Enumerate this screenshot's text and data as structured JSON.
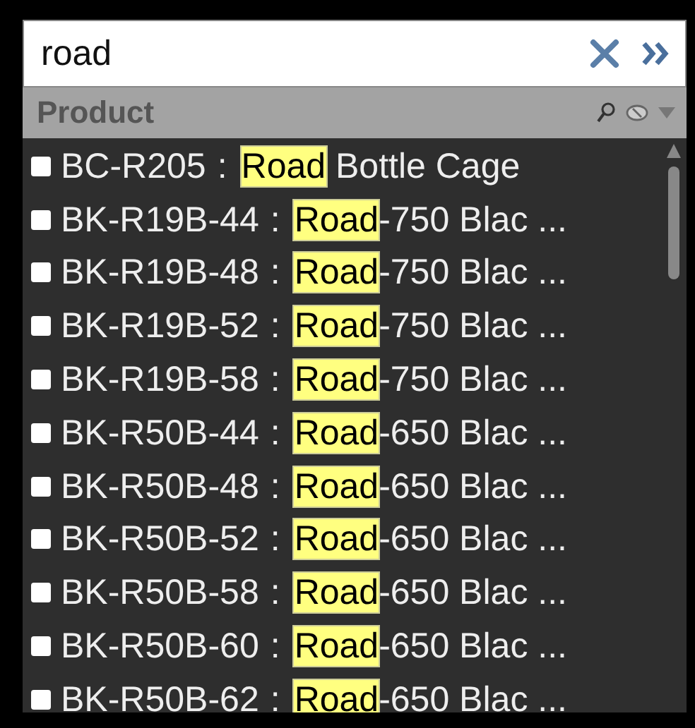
{
  "search": {
    "value": "road"
  },
  "header": {
    "title": "Product"
  },
  "items": [
    {
      "checked": false,
      "code": "BC-R205",
      "separator": ":",
      "match": "Road",
      "rest": " Bottle Cage"
    },
    {
      "checked": false,
      "code": "BK-R19B-44",
      "separator": ":",
      "match": "Road",
      "rest": "-750 Blac ..."
    },
    {
      "checked": false,
      "code": "BK-R19B-48",
      "separator": ":",
      "match": "Road",
      "rest": "-750 Blac ..."
    },
    {
      "checked": false,
      "code": "BK-R19B-52",
      "separator": ":",
      "match": "Road",
      "rest": "-750 Blac ..."
    },
    {
      "checked": false,
      "code": "BK-R19B-58",
      "separator": ":",
      "match": "Road",
      "rest": "-750 Blac ..."
    },
    {
      "checked": false,
      "code": "BK-R50B-44",
      "separator": ":",
      "match": "Road",
      "rest": "-650 Blac ..."
    },
    {
      "checked": false,
      "code": "BK-R50B-48",
      "separator": ":",
      "match": "Road",
      "rest": "-650 Blac ..."
    },
    {
      "checked": false,
      "code": "BK-R50B-52",
      "separator": ":",
      "match": "Road",
      "rest": "-650 Blac ..."
    },
    {
      "checked": false,
      "code": "BK-R50B-58",
      "separator": ":",
      "match": "Road",
      "rest": "-650 Blac ..."
    },
    {
      "checked": false,
      "code": "BK-R50B-60",
      "separator": ":",
      "match": "Road",
      "rest": "-650 Blac ..."
    },
    {
      "checked": false,
      "code": "BK-R50B-62",
      "separator": ":",
      "match": "Road",
      "rest": "-650 Blac ..."
    }
  ]
}
